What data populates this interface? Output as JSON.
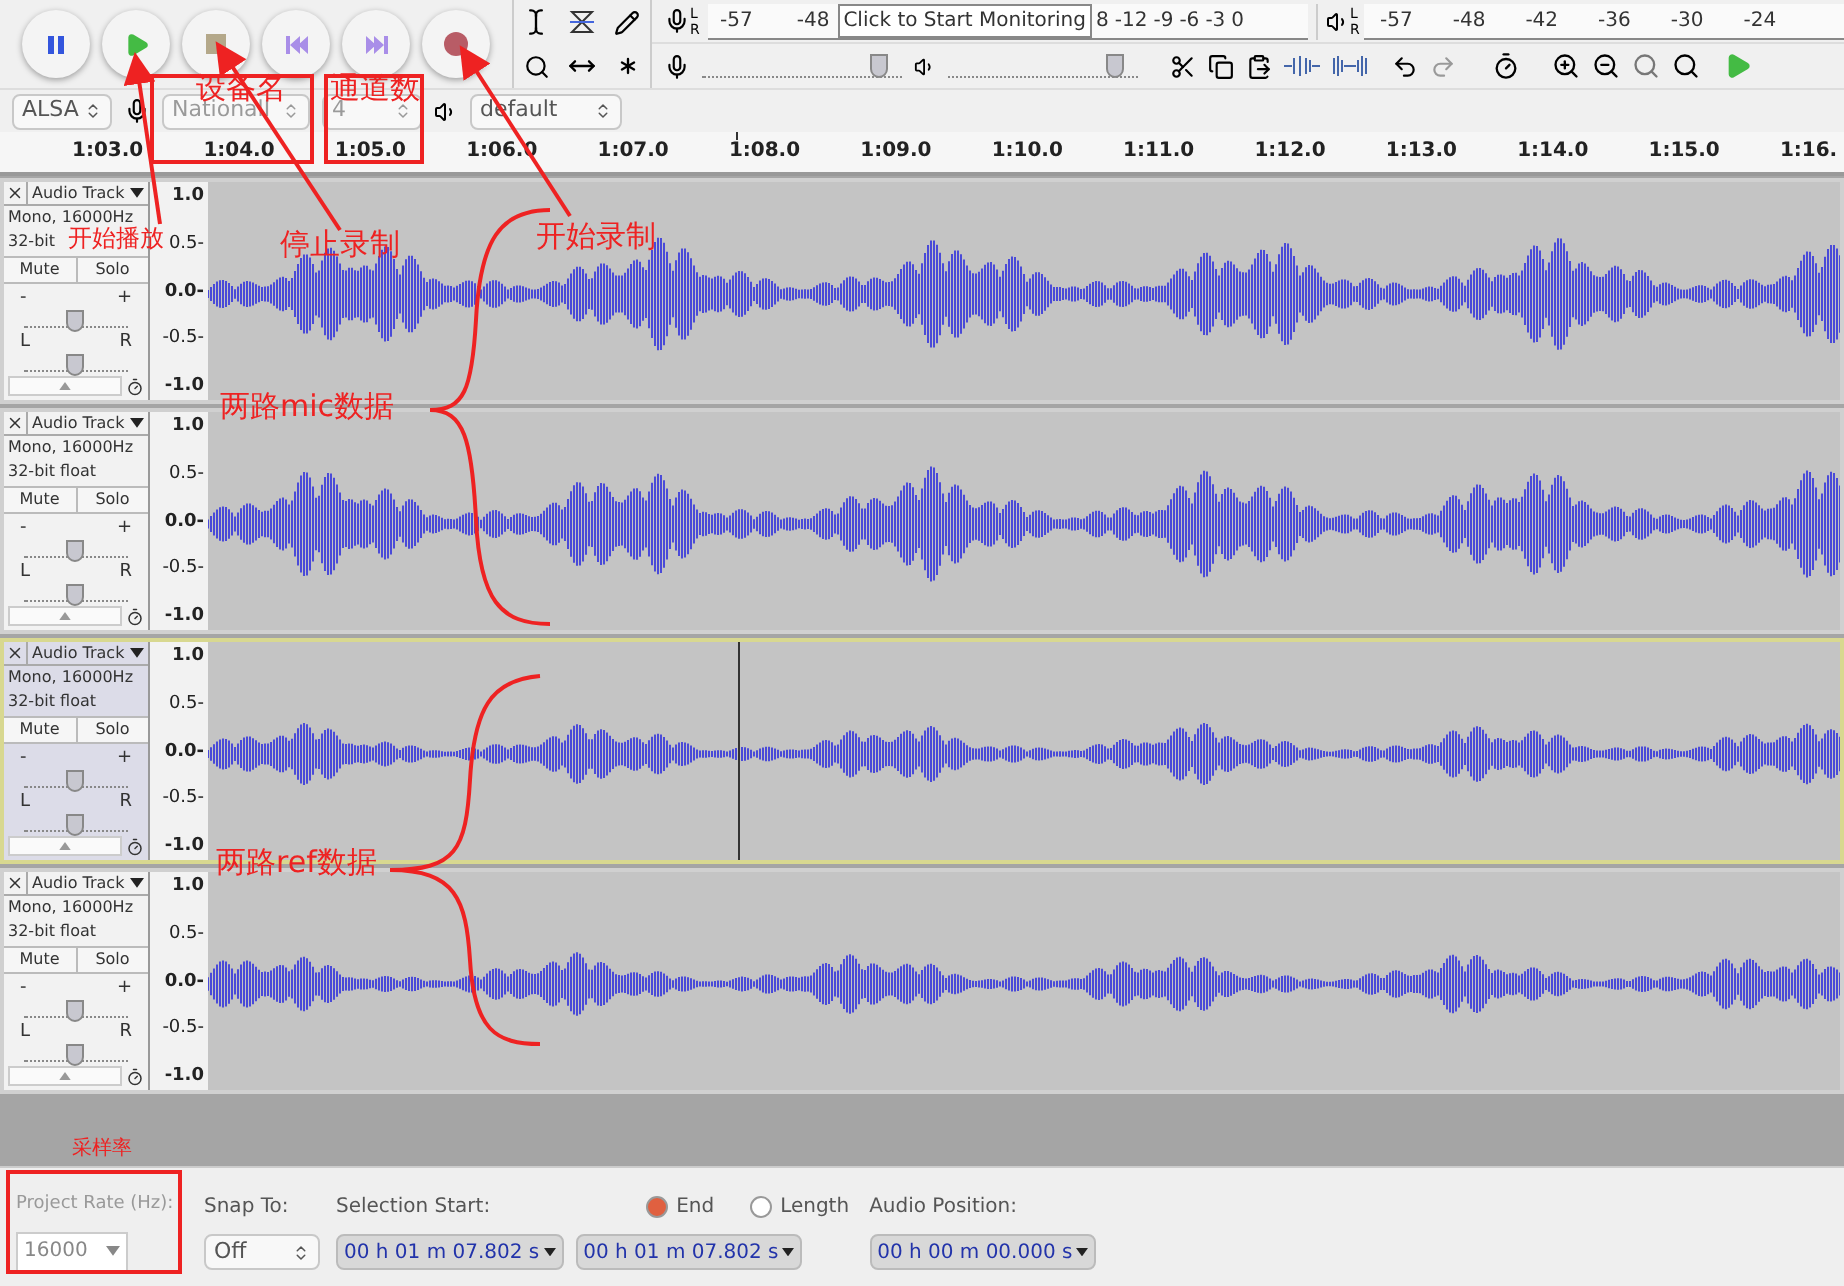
{
  "record_meter": {
    "channels": [
      "L",
      "R"
    ],
    "ticks": [
      "-57",
      "-48"
    ],
    "tooltip": "Click to Start Monitoring",
    "ticks_after": [
      "8",
      "-12",
      "-9",
      "-6",
      "-3",
      "0"
    ]
  },
  "playback_meter": {
    "channels": [
      "L",
      "R"
    ],
    "ticks": [
      "-57",
      "-48",
      "-42",
      "-36",
      "-30",
      "-24"
    ]
  },
  "input_volume": {
    "level": 0.93
  },
  "output_volume": {
    "level": 0.93
  },
  "devices": {
    "host": "ALSA",
    "input": "NationalI",
    "channels": "4",
    "output": "default"
  },
  "ruler": [
    "1:03.0",
    "1:04.0",
    "1:05.0",
    "1:06.0",
    "1:07.0",
    "1:08.0",
    "1:09.0",
    "1:10.0",
    "1:11.0",
    "1:12.0",
    "1:13.0",
    "1:14.0",
    "1:15.0",
    "1:16."
  ],
  "tracks": [
    {
      "name": "Audio Track",
      "info": "Mono, 16000Hz",
      "format": "32-bit",
      "mute": "Mute",
      "solo": "Solo",
      "selected": false,
      "gain": {
        "minus": "-",
        "plus": "+",
        "level": 0.5
      },
      "pan": {
        "left": "L",
        "right": "R",
        "level": 0.5
      },
      "scale": [
        "1.0",
        "0.5-",
        "0.0-",
        "-0.5-",
        "-1.0"
      ]
    },
    {
      "name": "Audio Track",
      "info": "Mono, 16000Hz",
      "format": "32-bit float",
      "mute": "Mute",
      "solo": "Solo",
      "selected": false,
      "gain": {
        "minus": "-",
        "plus": "+",
        "level": 0.5
      },
      "pan": {
        "left": "L",
        "right": "R",
        "level": 0.5
      },
      "scale": [
        "1.0",
        "0.5-",
        "0.0-",
        "-0.5-",
        "-1.0"
      ]
    },
    {
      "name": "Audio Track",
      "info": "Mono, 16000Hz",
      "format": "32-bit float",
      "mute": "Mute",
      "solo": "Solo",
      "selected": true,
      "gain": {
        "minus": "-",
        "plus": "+",
        "level": 0.5
      },
      "pan": {
        "left": "L",
        "right": "R",
        "level": 0.5
      },
      "scale": [
        "1.0",
        "0.5-",
        "0.0-",
        "-0.5-",
        "-1.0"
      ]
    },
    {
      "name": "Audio Track",
      "info": "Mono, 16000Hz",
      "format": "32-bit float",
      "mute": "Mute",
      "solo": "Solo",
      "selected": false,
      "gain": {
        "minus": "-",
        "plus": "+",
        "level": 0.5
      },
      "pan": {
        "left": "L",
        "right": "R",
        "level": 0.5
      },
      "scale": [
        "1.0",
        "0.5-",
        "0.0-",
        "-0.5-",
        "-1.0"
      ]
    }
  ],
  "status_bar": {
    "project_rate_label": "Project Rate (Hz):",
    "project_rate": "16000",
    "snap_label": "Snap To:",
    "snap": "Off",
    "selection_label": "Selection Start:",
    "end_option": {
      "label": "End",
      "selected": true
    },
    "length_option": {
      "label": "Length",
      "selected": false
    },
    "selection_start": "00 h 01 m 07.802 s",
    "selection_end": "00 h 01 m 07.802 s",
    "position_label": "Audio Position:",
    "position": "00 h 00 m 00.000 s"
  },
  "annotations": [
    {
      "text": "开始播放"
    },
    {
      "text": "设备名"
    },
    {
      "text": "通道数"
    },
    {
      "text": "停止录制"
    },
    {
      "text": "开始录制"
    },
    {
      "text": "两路mic数据"
    },
    {
      "text": "两路ref数据"
    },
    {
      "text": "采样率"
    }
  ]
}
